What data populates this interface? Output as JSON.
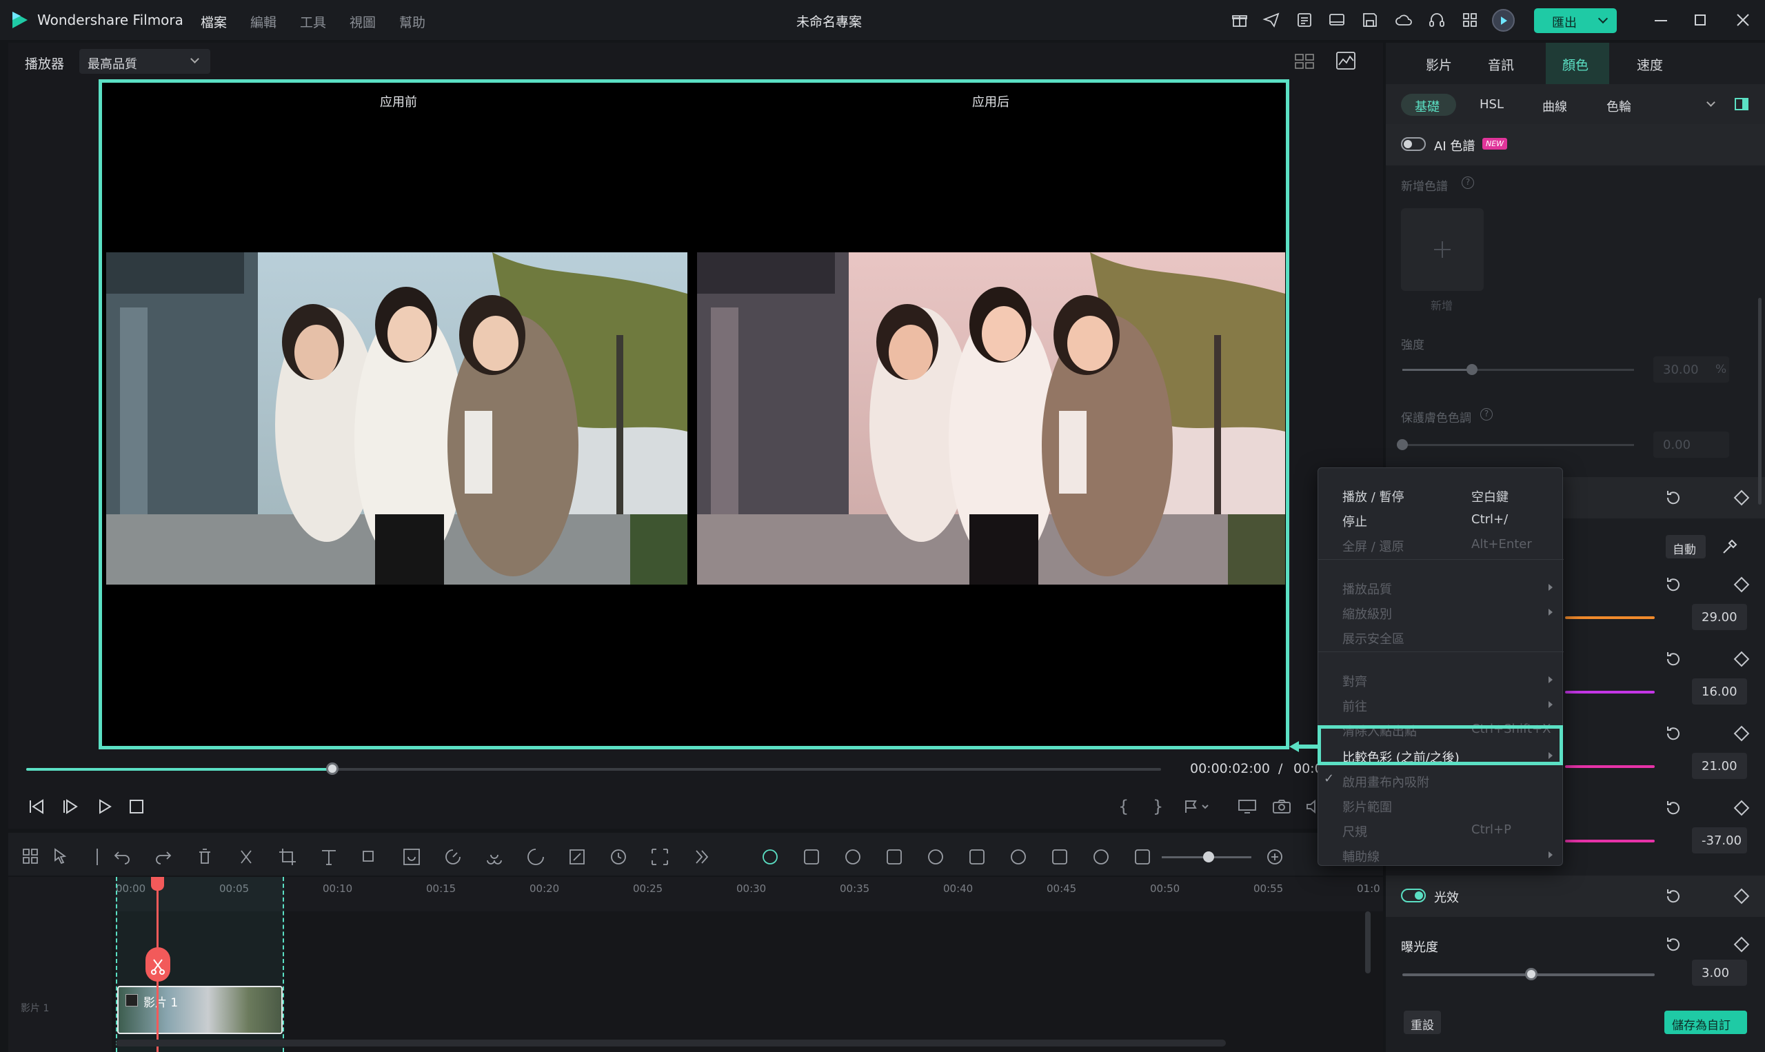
{
  "app": {
    "name": "Wondershare Filmora",
    "project_title": "未命名專案",
    "export_label": "匯出"
  },
  "menu": [
    "檔案",
    "編輯",
    "工具",
    "視圖",
    "幫助"
  ],
  "player": {
    "label": "播放器",
    "quality": "最高品質",
    "before_label": "应用前",
    "after_label": "应用后",
    "current_time": "00:00:02:00",
    "separator": "/",
    "total_time_partial": "00:0",
    "progress": 0.27
  },
  "right_panel": {
    "tabs": [
      "影片",
      "音訊",
      "顏色",
      "速度"
    ],
    "active_tab": "顏色",
    "subtabs": [
      "基礎",
      "HSL",
      "曲線",
      "色輪"
    ],
    "active_subtab": "基礎",
    "ai_palette": {
      "label": "AI 色譜",
      "badge": "NEW",
      "enabled": false
    },
    "add_palette_label": "新增色譜",
    "add_label": "新增",
    "strength": {
      "label": "強度",
      "value": "30.00",
      "unit": "%",
      "level": 0.3
    },
    "protect_skin": {
      "label": "保護膚色色調",
      "value": "0.00",
      "level": 0
    },
    "auto_label": "自動",
    "rows": [
      {
        "value": "29.00",
        "color": "#f08a2c"
      },
      {
        "value": "16.00",
        "color": "#c436e6"
      },
      {
        "value": "21.00",
        "color": "#e632a8"
      },
      {
        "value": "-37.00",
        "color": "#e632a8"
      }
    ],
    "light": {
      "label": "光效",
      "enabled": true
    },
    "exposure": {
      "label": "曝光度",
      "value": "3.00",
      "level": 0.51
    },
    "reset_label": "重設",
    "save_custom_label": "儲存為自訂"
  },
  "context_menu": {
    "items": [
      {
        "label": "播放 / 暫停",
        "shortcut": "空白鍵",
        "enabled": true
      },
      {
        "label": "停止",
        "shortcut": "Ctrl+/",
        "enabled": true
      },
      {
        "label": "全屏 / 還原",
        "shortcut": "Alt+Enter",
        "enabled": false
      },
      {
        "label": "播放品質",
        "submenu": true,
        "enabled": false
      },
      {
        "label": "縮放級別",
        "submenu": true,
        "enabled": false
      },
      {
        "label": "展示安全區",
        "enabled": false
      },
      {
        "label": "對齊",
        "submenu": true,
        "enabled": false
      },
      {
        "label": "前往",
        "submenu": true,
        "enabled": false
      },
      {
        "label": "清除入點出點",
        "shortcut": "Ctrl+Shift+X",
        "enabled": false
      },
      {
        "label": "比較色彩 (之前/之後)",
        "submenu": true,
        "enabled": true,
        "highlighted": true
      },
      {
        "label": "啟用畫布內吸附",
        "checked": true,
        "enabled": false
      },
      {
        "label": "影片範圍",
        "enabled": false
      },
      {
        "label": "尺規",
        "shortcut": "Ctrl+P",
        "enabled": false
      },
      {
        "label": "輔助線",
        "submenu": true,
        "enabled": false
      }
    ]
  },
  "timeline": {
    "ruler": [
      "00:00",
      "00:05",
      "00:10",
      "00:15",
      "00:20",
      "00:25",
      "00:30",
      "00:35",
      "00:40",
      "00:45",
      "00:50",
      "00:55",
      "01:0"
    ],
    "track_label": "影片 1",
    "clip_label": "影片 1"
  },
  "colors": {
    "accent": "#5be0c4",
    "export": "#1fcaa5",
    "bg": "#141619",
    "panel": "#1e2024"
  }
}
